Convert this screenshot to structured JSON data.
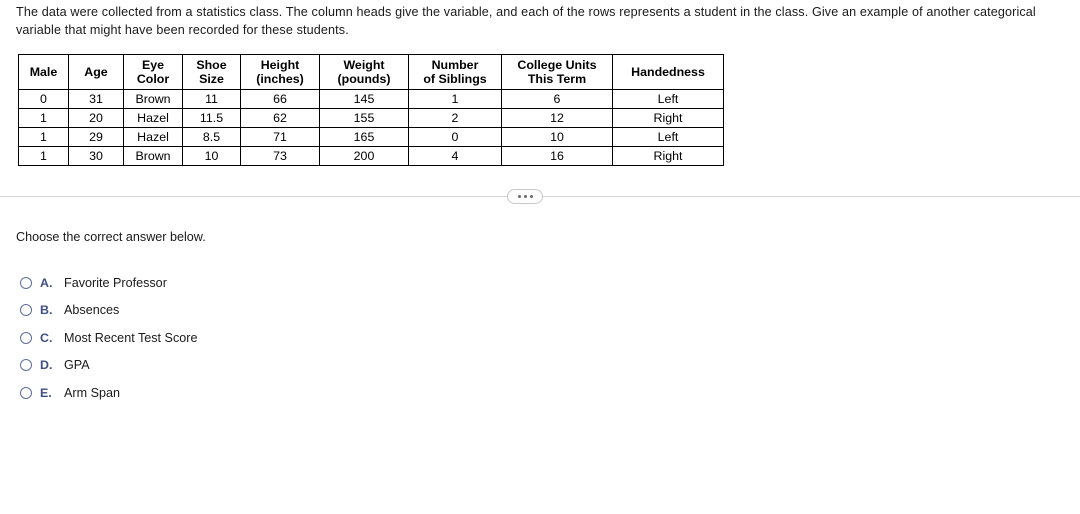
{
  "question": {
    "prompt": "The data were collected from a statistics class. The column heads give the variable, and each of the rows represents a student in the class. Give an example of another categorical variable that might have been recorded for these students."
  },
  "table": {
    "headers": [
      {
        "lines": [
          "Male"
        ]
      },
      {
        "lines": [
          "Age"
        ]
      },
      {
        "lines": [
          "Eye",
          "Color"
        ]
      },
      {
        "lines": [
          "Shoe",
          "Size"
        ]
      },
      {
        "lines": [
          "Height",
          "(inches)"
        ]
      },
      {
        "lines": [
          "Weight",
          "(pounds)"
        ]
      },
      {
        "lines": [
          "Number",
          "of Siblings"
        ]
      },
      {
        "lines": [
          "College Units",
          "This Term"
        ]
      },
      {
        "lines": [
          "Handedness"
        ]
      }
    ],
    "rows": [
      [
        "0",
        "31",
        "Brown",
        "11",
        "66",
        "145",
        "1",
        "6",
        "Left"
      ],
      [
        "1",
        "20",
        "Hazel",
        "11.5",
        "62",
        "155",
        "2",
        "12",
        "Right"
      ],
      [
        "1",
        "29",
        "Hazel",
        "8.5",
        "71",
        "165",
        "0",
        "10",
        "Left"
      ],
      [
        "1",
        "30",
        "Brown",
        "10",
        "73",
        "200",
        "4",
        "16",
        "Right"
      ]
    ]
  },
  "divider": {
    "ellipsis_label": "..."
  },
  "answer_section": {
    "instruction": "Choose the correct answer below.",
    "options": [
      {
        "letter": "A.",
        "label": "Favorite Professor",
        "selected": false
      },
      {
        "letter": "B.",
        "label": "Absences",
        "selected": false
      },
      {
        "letter": "C.",
        "label": "Most Recent Test Score",
        "selected": false
      },
      {
        "letter": "D.",
        "label": "GPA",
        "selected": false
      },
      {
        "letter": "E.",
        "label": "Arm Span",
        "selected": false
      }
    ]
  },
  "colors": {
    "text": "#1a1a1a",
    "radio_border": "#5e6e9e",
    "option_letter": "#3d4f86",
    "divider": "#d4d4d4",
    "table_border": "#000000"
  }
}
